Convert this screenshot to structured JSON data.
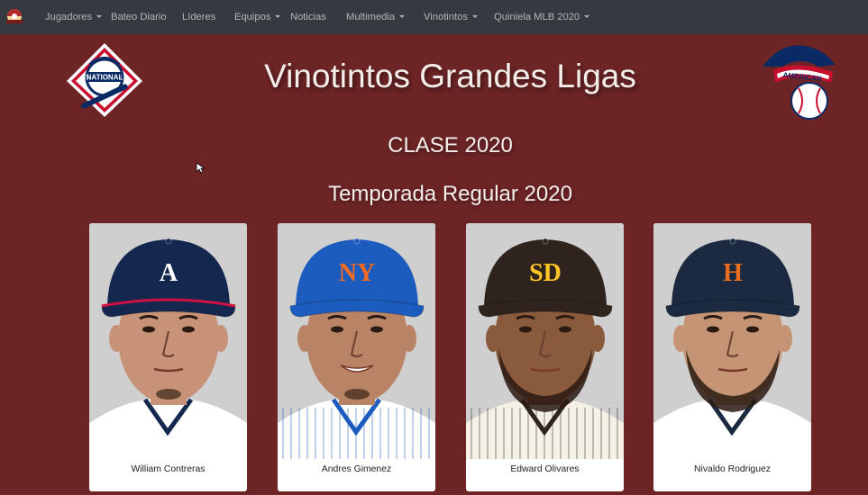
{
  "navbar": {
    "brand_icon": "vinotintos-logo-icon",
    "items": [
      {
        "label": "Jugadores",
        "dropdown": true
      },
      {
        "label": "Bateo Diario",
        "dropdown": false
      },
      {
        "label": "Líderes",
        "dropdown": false
      },
      {
        "label": "Equipos",
        "dropdown": true
      },
      {
        "label": "Noticias",
        "dropdown": false
      },
      {
        "label": "Multimedia",
        "dropdown": true
      },
      {
        "label": "Vinotintos",
        "dropdown": true
      },
      {
        "label": "Quiniela MLB 2020",
        "dropdown": true
      }
    ]
  },
  "header": {
    "title": "Vinotintos Grandes Ligas",
    "subtitle": "CLASE 2020",
    "season": "Temporada Regular 2020",
    "left_logo": "national-league-logo-icon",
    "right_logo": "american-league-logo-icon"
  },
  "players": [
    {
      "name": "William Contreras",
      "cap_color": "#13274f",
      "cap_logo": "A",
      "logo_color": "#ffffff"
    },
    {
      "name": "Andres Gimenez",
      "cap_color": "#1d5cbf",
      "cap_logo": "NY",
      "logo_color": "#f26a21"
    },
    {
      "name": "Edward Olivares",
      "cap_color": "#2f241d",
      "cap_logo": "SD",
      "logo_color": "#ffc425"
    },
    {
      "name": "Nivaldo Rodriguez",
      "cap_color": "#1b2a40",
      "cap_logo": "H",
      "logo_color": "#eb6e1f"
    }
  ],
  "colors": {
    "background": "#6d2425",
    "navbar": "#343a40"
  }
}
